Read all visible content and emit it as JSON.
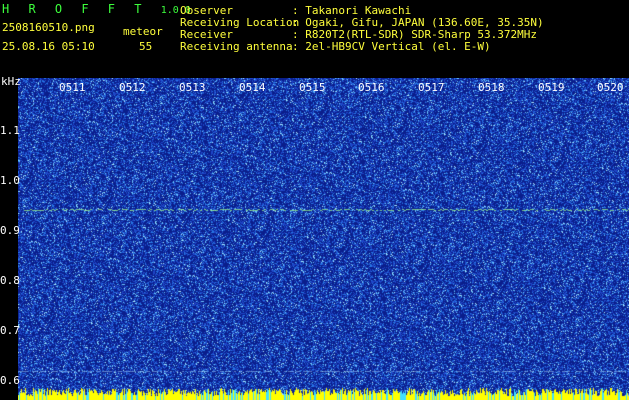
{
  "app": {
    "name": "H R O F F T",
    "version": "1.0.0",
    "filename": "2508160510.png",
    "datetime": "25.08.16 05:10",
    "meteor_label": "meteor",
    "meteor_count": "55"
  },
  "info": {
    "rows": [
      {
        "label": "Observer",
        "value": ": Takanori Kawachi"
      },
      {
        "label": "Receiving Location",
        "value": ": Ogaki, Gifu, JAPAN (136.60E, 35.35N)"
      },
      {
        "label": "Receiver",
        "value": ": R820T2(RTL-SDR) SDR-Sharp 53.372MHz"
      },
      {
        "label": "Receiving antenna",
        "value": ": 2el-HB9CV Vertical (el. E-W)"
      }
    ]
  },
  "axis": {
    "unit": "kHz",
    "y_ticks": [
      "1.1",
      "1.0",
      "0.9",
      "0.8",
      "0.7",
      "0.6"
    ],
    "x_ticks": [
      "0511",
      "0512",
      "0513",
      "0514",
      "0515",
      "0516",
      "0517",
      "0518",
      "0519",
      "0520"
    ]
  },
  "colors": {
    "background": "#0a1e8c",
    "noise": "#1e46c8",
    "bright": "#7ed2ff",
    "signal": "#c8ff78",
    "bottom_bar": "#ffff00",
    "text_green": "#3cff3c",
    "text_yellow": "#ffff3c"
  }
}
